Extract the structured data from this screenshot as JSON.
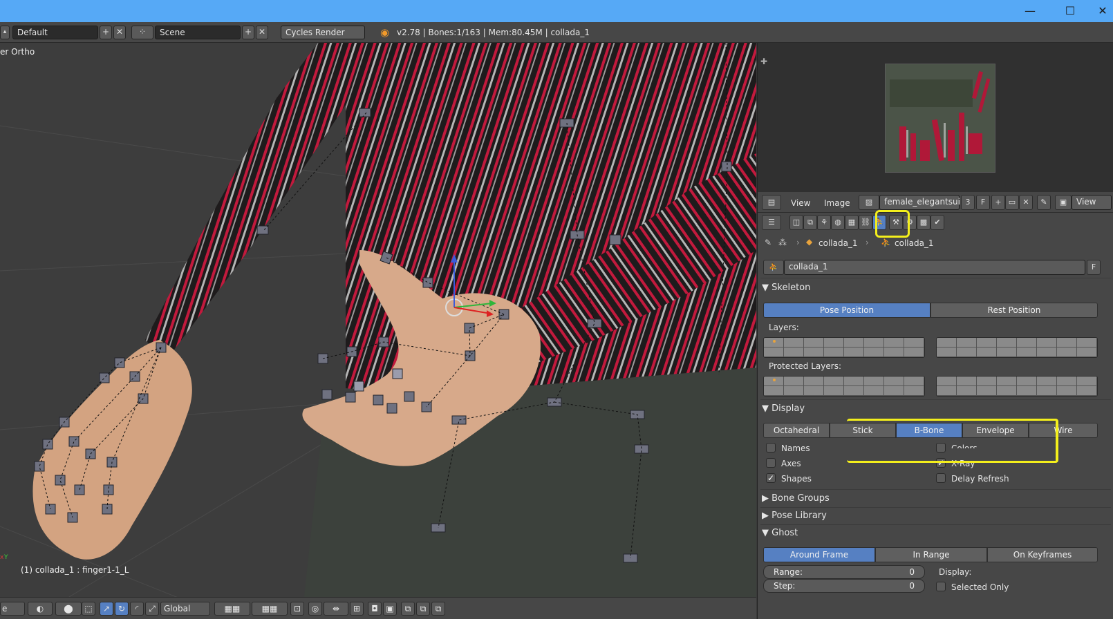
{
  "window": {
    "minimize": "—",
    "maximize": "☐",
    "close": "✕"
  },
  "infobar": {
    "layout": "Default",
    "scene": "Scene",
    "engine": "Cycles Render",
    "stats": "v2.78 | Bones:1/163 | Mem:80.45M | collada_1",
    "add": "+",
    "remove": "✕"
  },
  "viewport": {
    "view_label": "er Ortho",
    "selection_label": "(1) collada_1 : finger1-1_L",
    "axis_y": "Y",
    "axis_x": "x"
  },
  "bottombar": {
    "mode_partial": "e",
    "orientation": "Global"
  },
  "image_editor": {
    "menu_view": "View",
    "menu_image": "Image",
    "image_name": "female_elegantsui...",
    "users": "3",
    "fake": "F",
    "view_btn": "View"
  },
  "properties": {
    "breadcrumb": {
      "object": "collada_1",
      "data": "collada_1"
    },
    "datablock": "collada_1",
    "datablock_f": "F",
    "skeleton": {
      "title": "Skeleton",
      "pose_position": "Pose Position",
      "rest_position": "Rest Position",
      "layers": "Layers:",
      "protected_layers": "Protected Layers:"
    },
    "display": {
      "title": "Display",
      "modes": [
        "Octahedral",
        "Stick",
        "B-Bone",
        "Envelope",
        "Wire"
      ],
      "active_mode": "B-Bone",
      "names": "Names",
      "colors": "Colors",
      "axes": "Axes",
      "xray": "X-Ray",
      "shapes": "Shapes",
      "delay_refresh": "Delay Refresh",
      "check_mark": "✓"
    },
    "bone_groups": "Bone Groups",
    "pose_library": "Pose Library",
    "ghost": {
      "title": "Ghost",
      "around_frame": "Around Frame",
      "in_range": "In Range",
      "on_keyframes": "On Keyframes",
      "range_label": "Range:",
      "range_value": "0",
      "step_label": "Step:",
      "step_value": "0",
      "display_label": "Display:",
      "selected_only": "Selected Only"
    }
  },
  "colors": {
    "accent": "#5680c2",
    "highlight": "#f4ef1c",
    "titlebar": "#56a9f6"
  }
}
